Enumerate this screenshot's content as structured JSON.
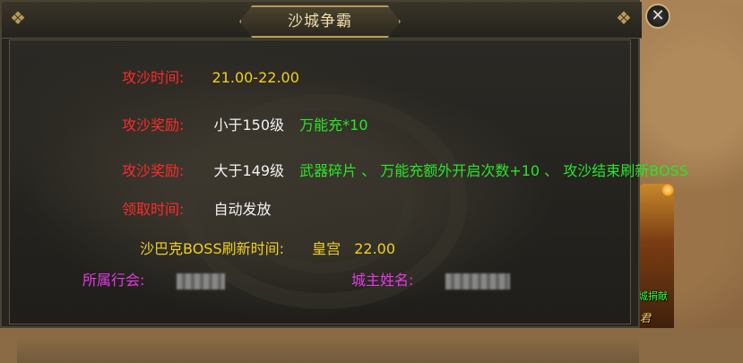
{
  "dialog": {
    "title": "沙城争霸",
    "close_icon": "✕"
  },
  "rows": {
    "time": {
      "label": "攻沙时间:",
      "value": "21.00-22.00"
    },
    "reward1": {
      "label": "攻沙奖励:",
      "condition": "小于150级",
      "reward": "万能充*10"
    },
    "reward2": {
      "label": "攻沙奖励:",
      "condition": "大于149级",
      "reward": "武器碎片 、 万能充额外开启次数+10 、 攻沙结束刷新BOSS"
    },
    "claim": {
      "label": "领取时间:",
      "value": "自动发放"
    },
    "boss": {
      "label": "沙巴克BOSS刷新时间:",
      "place": "皇宫",
      "time": "22.00"
    },
    "guild": {
      "label": "所属行会:"
    },
    "owner": {
      "label": "城主姓名:"
    }
  },
  "side": {
    "label1": "城捐献",
    "label2": "君"
  },
  "colors": {
    "label_red": "#ff2a2a",
    "value_yellow": "#f0d020",
    "reward_green": "#29e629",
    "label_magenta": "#e23ce2",
    "title_gold": "#f2dfa8"
  }
}
